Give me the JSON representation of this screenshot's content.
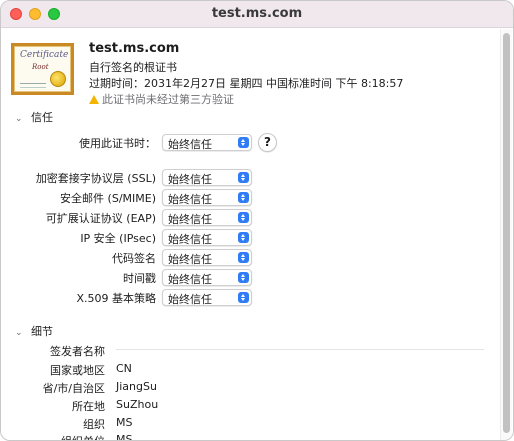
{
  "window": {
    "title": "test.ms.com"
  },
  "certificate": {
    "name": "test.ms.com",
    "type": "自行签名的根证书",
    "expiry": "过期时间：2031年2月27日 星期四 中国标准时间 下午 8:18:57",
    "warning": "此证书尚未经过第三方验证",
    "icon_text_1": "Certificate",
    "icon_text_2": "Root"
  },
  "trust": {
    "section_label": "信任",
    "use_label": "使用此证书时：",
    "use_value": "始终信任",
    "help_label": "?",
    "rows": [
      {
        "label": "加密套接字协议层 (SSL)",
        "value": "始终信任"
      },
      {
        "label": "安全邮件 (S/MIME)",
        "value": "始终信任"
      },
      {
        "label": "可扩展认证协议 (EAP)",
        "value": "始终信任"
      },
      {
        "label": "IP 安全 (IPsec)",
        "value": "始终信任"
      },
      {
        "label": "代码签名",
        "value": "始终信任"
      },
      {
        "label": "时间戳",
        "value": "始终信任"
      },
      {
        "label": "X.509 基本策略",
        "value": "始终信任"
      }
    ]
  },
  "details": {
    "section_label": "细节",
    "issuer_heading": "签发者名称",
    "fields": [
      {
        "label": "国家或地区",
        "value": "CN"
      },
      {
        "label": "省/市/自治区",
        "value": "JiangSu"
      },
      {
        "label": "所在地",
        "value": "SuZhou"
      },
      {
        "label": "组织",
        "value": "MS"
      },
      {
        "label": "组织单位",
        "value": "MS"
      }
    ]
  }
}
